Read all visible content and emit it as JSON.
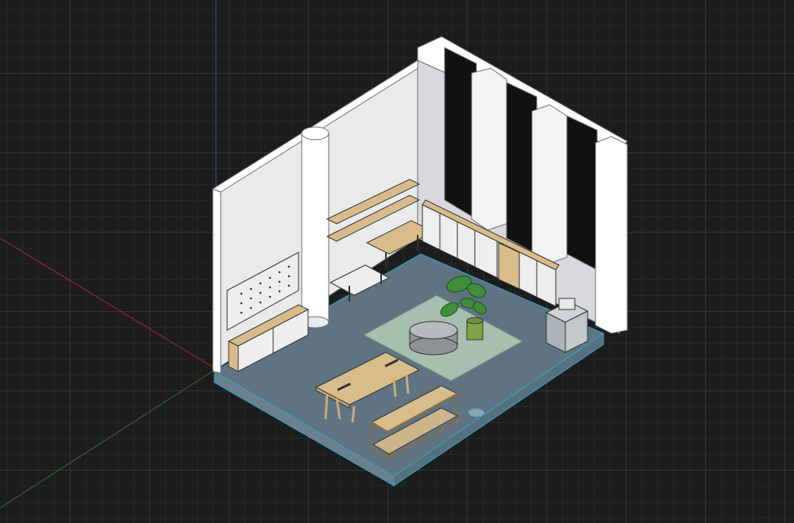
{
  "viewport": {
    "kind": "3D modeling workspace",
    "view": "isometric"
  },
  "scene": {
    "icons": [
      "axis-lines",
      "room-model",
      "plant",
      "table",
      "shelves",
      "cabinets",
      "rug",
      "pouf"
    ]
  },
  "colors": {
    "background": "#1c1c1c",
    "grid_major": "#333333",
    "grid_minor": "#262626",
    "axis_red": "#9b2d2d",
    "axis_green": "#2e6e2e",
    "axis_blue": "#2b5b8a",
    "floor": "#5f7382",
    "floor_edge": "#2aa6c4",
    "wall": "#e9eaec",
    "wood": "#d8bd8b",
    "rug": "#a7bfae",
    "plant": "#3f8f3a"
  }
}
